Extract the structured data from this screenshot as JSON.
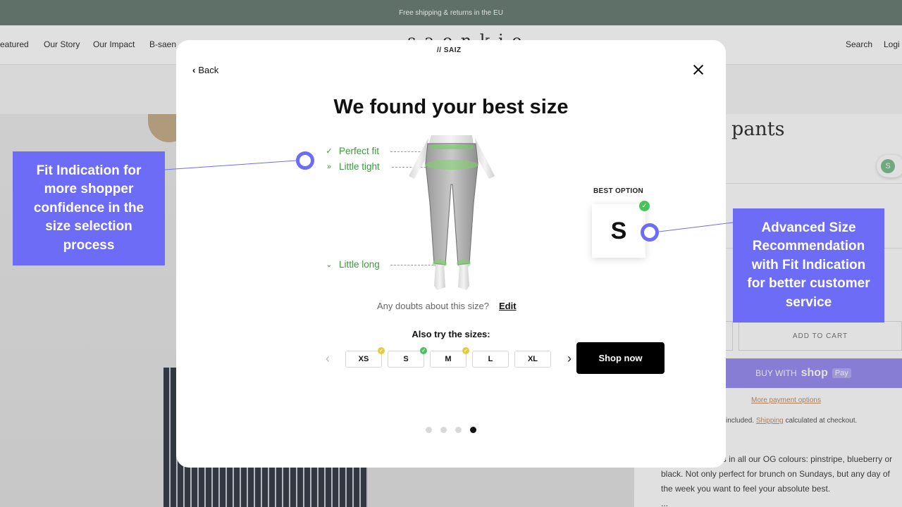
{
  "store": {
    "announcement": "Free shipping & returns in the EU",
    "nav": [
      "eatured",
      "Our Story",
      "Our Impact",
      "B-saen"
    ],
    "nav_right": [
      "Search",
      "Logi"
    ],
    "brand": "s a e n  k i e",
    "product_title": "n pants",
    "saiz_badge_letter": "S",
    "add_to_cart": "ADD TO CART",
    "buy_with": "BUY WITH",
    "shop_word": "shop",
    "pay_word": "Pay",
    "more_payment": "More payment options",
    "tax_prefix": "included.",
    "shipping_link": "Shipping",
    "tax_suffix": "calculated at checkout.",
    "description": "ride-legged pants in all our OG colours: pinstripe, blueberry or black. Not only perfect for brunch on Sundays, but any day of the week you want to feel your absolute best.",
    "desc_more": "..."
  },
  "modal": {
    "logo": "// SAIZ",
    "back_label": "Back",
    "title": "We found your best size",
    "fit_indications": [
      {
        "icon": "check",
        "glyph": "✓",
        "label": "Perfect fit"
      },
      {
        "icon": "double-chevron-right",
        "glyph": "»",
        "label": "Little tight"
      },
      {
        "icon": "double-chevron-down",
        "glyph": "⌄",
        "label": "Little long"
      }
    ],
    "best_option_label": "BEST OPTION",
    "best_size": "S",
    "doubts_text": "Any doubts about this size?",
    "edit_label": "Edit",
    "also_try": "Also try the sizes:",
    "sizes": [
      {
        "label": "XS",
        "status": "yellow"
      },
      {
        "label": "S",
        "status": "green"
      },
      {
        "label": "M",
        "status": "yellow"
      },
      {
        "label": "L",
        "status": "none"
      },
      {
        "label": "XL",
        "status": "none"
      }
    ],
    "shop_now": "Shop now",
    "pager": {
      "count": 4,
      "active": 4
    }
  },
  "annotations": {
    "left": "Fit Indication for more shopper confidence in the size selection process",
    "right": "Advanced Size Recommendation with Fit Indication for better customer service"
  },
  "colors": {
    "callout": "#6c6cf6",
    "fit_green": "#3a9a3a",
    "status_green": "#47c35a",
    "status_yellow": "#e8c93a",
    "announcement_bar": "#6b8076",
    "shop_pay": "#9a8ff2"
  }
}
